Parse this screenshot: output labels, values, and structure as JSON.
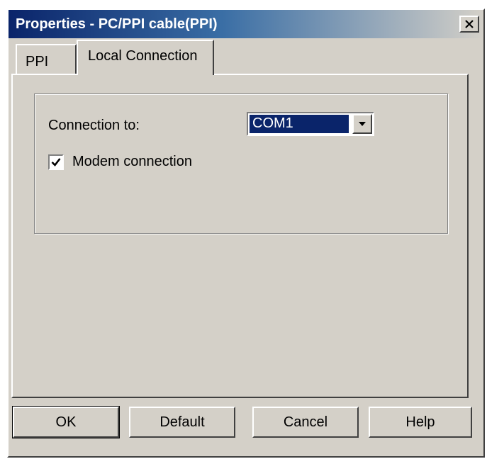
{
  "window": {
    "title": "Properties - PC/PPI cable(PPI)",
    "close_icon": "close-icon"
  },
  "tabs": [
    {
      "label": "PPI",
      "active": false
    },
    {
      "label": "Local Connection",
      "active": true
    }
  ],
  "local_connection": {
    "connection_label": "Connection to:",
    "connection_value": "COM1",
    "modem_label": "Modem connection",
    "modem_checked": true
  },
  "buttons": {
    "ok": "OK",
    "default": "Default",
    "cancel": "Cancel",
    "help": "Help"
  },
  "colors": {
    "title_bar": "#0a246a",
    "face": "#d4d0c8",
    "selection": "#0a246a"
  }
}
